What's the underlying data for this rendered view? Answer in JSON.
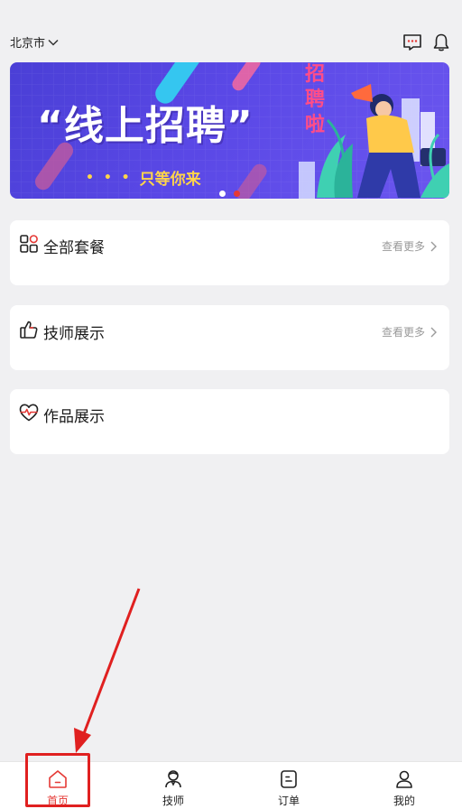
{
  "header": {
    "city": "北京市"
  },
  "banner": {
    "headline": "“线上招聘”",
    "subline": "只等你来",
    "subline_dots": "• • •",
    "side_text": [
      "招",
      "聘",
      "啦"
    ],
    "indicator_count": 2,
    "active_indicator": 2
  },
  "sections": [
    {
      "title": "全部套餐",
      "more": "查看更多",
      "icon": "grid-icon"
    },
    {
      "title": "技师展示",
      "more": "查看更多",
      "icon": "thumbs-up-icon"
    },
    {
      "title": "作品展示",
      "icon": "heart-pulse-icon"
    }
  ],
  "tabbar": {
    "items": [
      {
        "label": "首页",
        "icon": "home-icon",
        "active": true
      },
      {
        "label": "技师",
        "icon": "technician-icon",
        "active": false
      },
      {
        "label": "订单",
        "icon": "order-icon",
        "active": false
      },
      {
        "label": "我的",
        "icon": "profile-icon",
        "active": false
      }
    ]
  },
  "colors": {
    "accent": "#e53935",
    "banner_bg": "#5a48e6",
    "banner_sub": "#ffd54a",
    "annotation": "#e02020"
  }
}
